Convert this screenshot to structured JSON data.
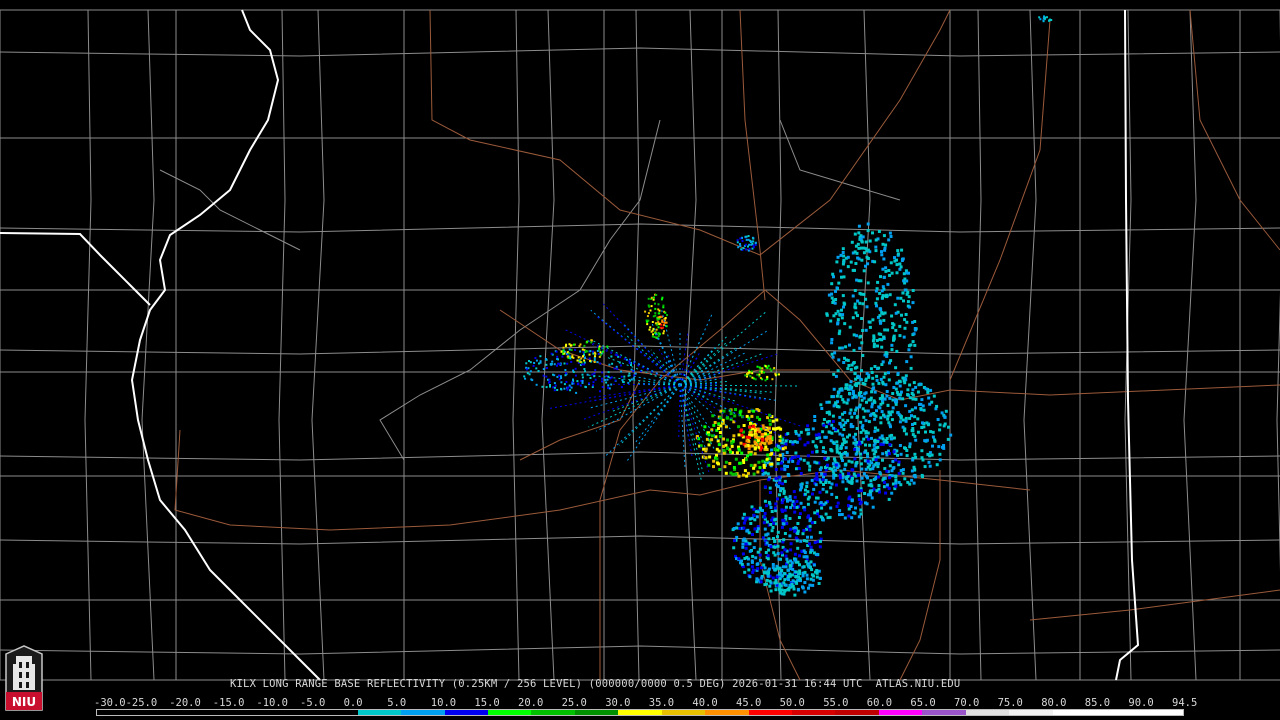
{
  "caption": "KILX LONG RANGE BASE REFLECTIVITY (0.25KM / 256 LEVEL) (000000/0000 0.5 DEG) 2026-01-31 16:44 UTC  ATLAS.NIU.EDU",
  "logo": {
    "text": "NIU",
    "icon": "niu-tower-icon"
  },
  "colors": {
    "background": "#000000",
    "county_lines": "#8c8c8c",
    "state_lines": "#ffffff",
    "highways": "#9b5a3a"
  },
  "scale": {
    "labels": [
      "-30.0",
      "-25.0",
      "-20.0",
      "-15.0",
      "-10.0",
      "-5.0",
      "0.0",
      "5.0",
      "10.0",
      "15.0",
      "20.0",
      "25.0",
      "30.0",
      "35.0",
      "40.0",
      "45.0",
      "50.0",
      "55.0",
      "60.0",
      "65.0",
      "70.0",
      "75.0",
      "80.0",
      "85.0",
      "90.0",
      "94.5"
    ],
    "colors": [
      "#000000",
      "#000000",
      "#000000",
      "#000000",
      "#000000",
      "#000000",
      "#00c8c8",
      "#00a0f0",
      "#0000f0",
      "#00ff00",
      "#00c000",
      "#009000",
      "#ffff00",
      "#e7c000",
      "#ff9000",
      "#ff0000",
      "#d60000",
      "#c00000",
      "#ff00ff",
      "#9955c9",
      "#e0e0e0",
      "#f0f0f0",
      "#ffffff",
      "#ffffff",
      "#ffffff"
    ]
  },
  "radar": {
    "site": "KILX"
  }
}
